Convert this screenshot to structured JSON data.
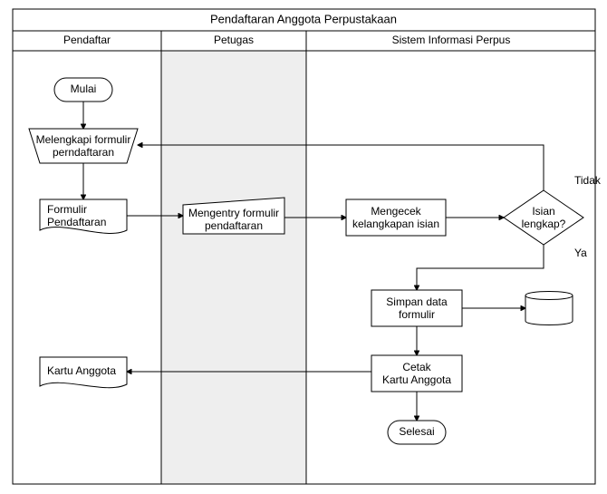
{
  "diagram": {
    "title": "Pendaftaran Anggota  Perpustakaan",
    "lanes": {
      "pendaftar": "Pendaftar",
      "petugas": "Petugas",
      "sistem": "Sistem Informasi Perpus"
    },
    "nodes": {
      "start": "Mulai",
      "fill_form_l1": "Melengkapi formulir",
      "fill_form_l2": "perndaftaran",
      "form_doc_l1": "Formulir",
      "form_doc_l2": "Pendaftaran",
      "entry_l1": "Mengentry formulir",
      "entry_l2": "pendaftaran",
      "check_l1": "Mengecek",
      "check_l2": "kelangkapan isian",
      "decision_l1": "Isian",
      "decision_l2": "lengkap?",
      "decision_no": "Tidak",
      "decision_yes": "Ya",
      "save_l1": "Simpan data",
      "save_l2": "formulir",
      "print_l1": "Cetak",
      "print_l2": "Kartu Anggota",
      "card_doc": "Kartu Anggota",
      "end": "Selesai"
    }
  }
}
